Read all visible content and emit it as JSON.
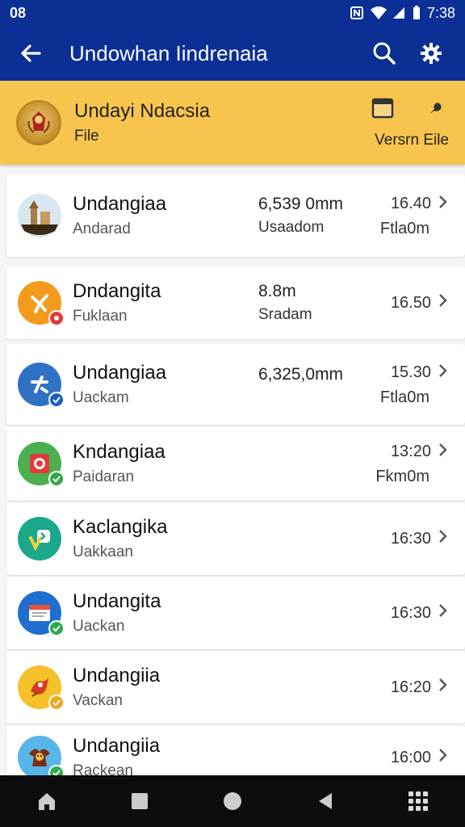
{
  "status_bar": {
    "time_left": "08",
    "time_right": "7:38"
  },
  "app_bar": {
    "title": "Undowhan Iindrenaia"
  },
  "banner": {
    "title": "Undayi Ndacsia",
    "subtitle": "File",
    "action_label": "Versrn Eile"
  },
  "rows": [
    {
      "name": "Undangiaa",
      "sub": "Andarad",
      "mid1": "6,539 0mm",
      "mid2": "Usaadom",
      "time": "16.40",
      "time2": "Ftla0m",
      "avatar_color": "#d9e7f2",
      "badge_color": ""
    },
    {
      "name": "Dndangita",
      "sub": "Fuklaan",
      "mid1": "8.8m",
      "mid2": "Sradam",
      "time": "16.50",
      "time2": "",
      "avatar_color": "#f49a1c",
      "badge_color": "#e53935"
    },
    {
      "name": "Undangiaa",
      "sub": "Uackam",
      "mid1": "6,325,0mm",
      "mid2": "",
      "time": "15.30",
      "time2": "Ftla0m",
      "avatar_color": "#2f72c4",
      "badge_color": "#1e5fc2"
    },
    {
      "name": "Kndangiaa",
      "sub": "Paidaran",
      "mid1": "",
      "mid2": "",
      "time": "13:20",
      "time2": "Fkm0m",
      "avatar_color": "#4caf50",
      "badge_color": "#2eaa4a"
    },
    {
      "name": "Kaclangika",
      "sub": "Uakkaan",
      "mid1": "",
      "mid2": "",
      "time": "16:30",
      "time2": "",
      "avatar_color": "#1ba88a",
      "badge_color": ""
    },
    {
      "name": "Undangita",
      "sub": "Uackan",
      "mid1": "",
      "mid2": "",
      "time": "16:30",
      "time2": "",
      "avatar_color": "#1f6fd1",
      "badge_color": "#2eaa4a"
    },
    {
      "name": "Undangiia",
      "sub": "Vackan",
      "mid1": "",
      "mid2": "",
      "time": "16:20",
      "time2": "",
      "avatar_color": "#f5c02a",
      "badge_color": "#f0a81c"
    },
    {
      "name": "Undangiia",
      "sub": "Rackean",
      "mid1": "",
      "mid2": "",
      "time": "16:00",
      "time2": "",
      "avatar_color": "#57b5e8",
      "badge_color": "#2eaa4a"
    }
  ],
  "icons": {
    "back": "arrow-left-icon",
    "search": "search-icon",
    "settings": "gear-icon",
    "version": "document-icon",
    "pin": "pin-icon"
  }
}
